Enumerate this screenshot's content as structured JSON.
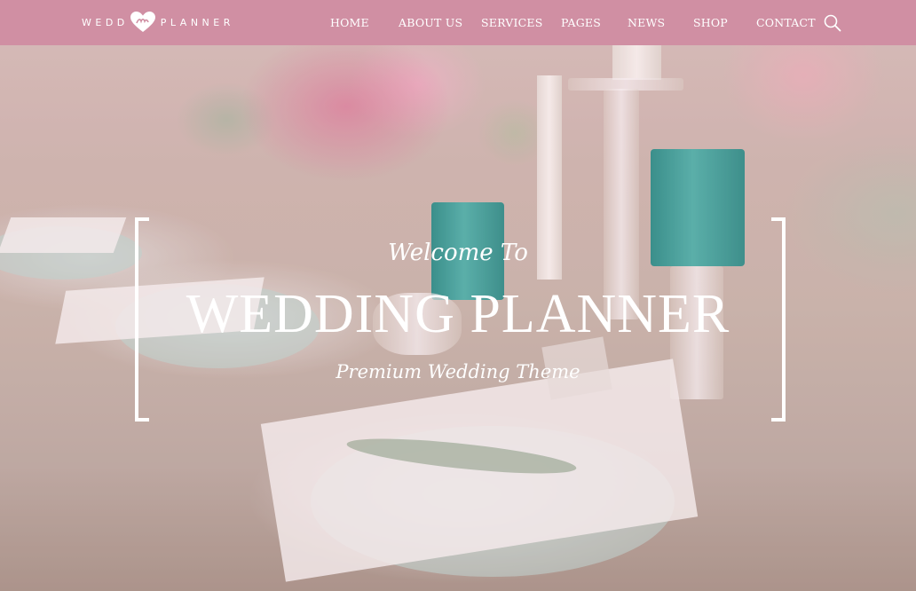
{
  "header": {
    "logo": {
      "left": "WEDD",
      "right": "PLANNER",
      "mark": "heart-logo-icon"
    },
    "nav": [
      {
        "label": "HOME"
      },
      {
        "label": "ABOUT US"
      },
      {
        "label": "SERVICES"
      },
      {
        "label": "PAGES"
      },
      {
        "label": "NEWS"
      },
      {
        "label": "SHOP"
      },
      {
        "label": "CONTACT"
      }
    ],
    "search_icon": "search-icon"
  },
  "hero": {
    "welcome": "Welcome To",
    "title": "WEDDING PLANNER",
    "subtitle": "Premium Wedding Theme"
  },
  "colors": {
    "header_bg": "#d08fa3",
    "text": "#ffffff",
    "candle_teal": "#2a9e94"
  }
}
